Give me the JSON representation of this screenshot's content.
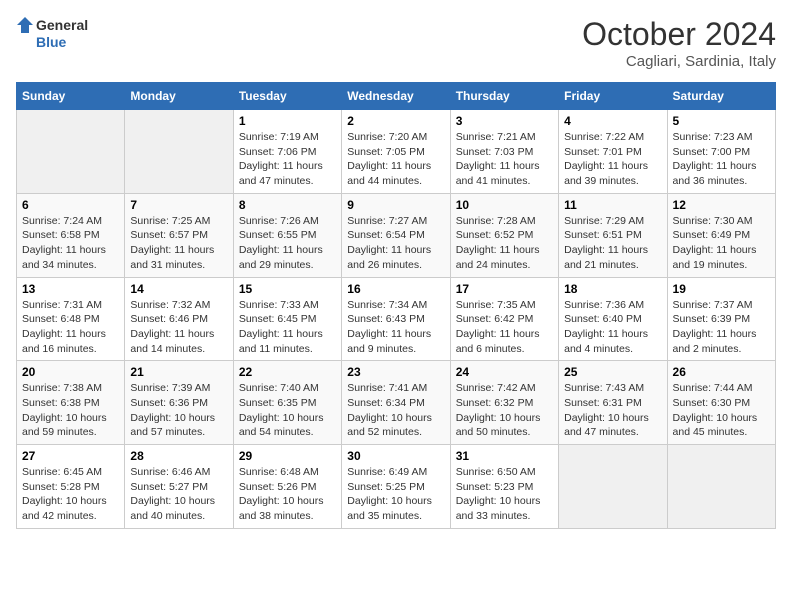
{
  "header": {
    "logo_line1": "General",
    "logo_line2": "Blue",
    "month": "October 2024",
    "location": "Cagliari, Sardinia, Italy"
  },
  "weekdays": [
    "Sunday",
    "Monday",
    "Tuesday",
    "Wednesday",
    "Thursday",
    "Friday",
    "Saturday"
  ],
  "weeks": [
    [
      {
        "day": null
      },
      {
        "day": null
      },
      {
        "day": "1",
        "sunrise": "Sunrise: 7:19 AM",
        "sunset": "Sunset: 7:06 PM",
        "daylight": "Daylight: 11 hours and 47 minutes."
      },
      {
        "day": "2",
        "sunrise": "Sunrise: 7:20 AM",
        "sunset": "Sunset: 7:05 PM",
        "daylight": "Daylight: 11 hours and 44 minutes."
      },
      {
        "day": "3",
        "sunrise": "Sunrise: 7:21 AM",
        "sunset": "Sunset: 7:03 PM",
        "daylight": "Daylight: 11 hours and 41 minutes."
      },
      {
        "day": "4",
        "sunrise": "Sunrise: 7:22 AM",
        "sunset": "Sunset: 7:01 PM",
        "daylight": "Daylight: 11 hours and 39 minutes."
      },
      {
        "day": "5",
        "sunrise": "Sunrise: 7:23 AM",
        "sunset": "Sunset: 7:00 PM",
        "daylight": "Daylight: 11 hours and 36 minutes."
      }
    ],
    [
      {
        "day": "6",
        "sunrise": "Sunrise: 7:24 AM",
        "sunset": "Sunset: 6:58 PM",
        "daylight": "Daylight: 11 hours and 34 minutes."
      },
      {
        "day": "7",
        "sunrise": "Sunrise: 7:25 AM",
        "sunset": "Sunset: 6:57 PM",
        "daylight": "Daylight: 11 hours and 31 minutes."
      },
      {
        "day": "8",
        "sunrise": "Sunrise: 7:26 AM",
        "sunset": "Sunset: 6:55 PM",
        "daylight": "Daylight: 11 hours and 29 minutes."
      },
      {
        "day": "9",
        "sunrise": "Sunrise: 7:27 AM",
        "sunset": "Sunset: 6:54 PM",
        "daylight": "Daylight: 11 hours and 26 minutes."
      },
      {
        "day": "10",
        "sunrise": "Sunrise: 7:28 AM",
        "sunset": "Sunset: 6:52 PM",
        "daylight": "Daylight: 11 hours and 24 minutes."
      },
      {
        "day": "11",
        "sunrise": "Sunrise: 7:29 AM",
        "sunset": "Sunset: 6:51 PM",
        "daylight": "Daylight: 11 hours and 21 minutes."
      },
      {
        "day": "12",
        "sunrise": "Sunrise: 7:30 AM",
        "sunset": "Sunset: 6:49 PM",
        "daylight": "Daylight: 11 hours and 19 minutes."
      }
    ],
    [
      {
        "day": "13",
        "sunrise": "Sunrise: 7:31 AM",
        "sunset": "Sunset: 6:48 PM",
        "daylight": "Daylight: 11 hours and 16 minutes."
      },
      {
        "day": "14",
        "sunrise": "Sunrise: 7:32 AM",
        "sunset": "Sunset: 6:46 PM",
        "daylight": "Daylight: 11 hours and 14 minutes."
      },
      {
        "day": "15",
        "sunrise": "Sunrise: 7:33 AM",
        "sunset": "Sunset: 6:45 PM",
        "daylight": "Daylight: 11 hours and 11 minutes."
      },
      {
        "day": "16",
        "sunrise": "Sunrise: 7:34 AM",
        "sunset": "Sunset: 6:43 PM",
        "daylight": "Daylight: 11 hours and 9 minutes."
      },
      {
        "day": "17",
        "sunrise": "Sunrise: 7:35 AM",
        "sunset": "Sunset: 6:42 PM",
        "daylight": "Daylight: 11 hours and 6 minutes."
      },
      {
        "day": "18",
        "sunrise": "Sunrise: 7:36 AM",
        "sunset": "Sunset: 6:40 PM",
        "daylight": "Daylight: 11 hours and 4 minutes."
      },
      {
        "day": "19",
        "sunrise": "Sunrise: 7:37 AM",
        "sunset": "Sunset: 6:39 PM",
        "daylight": "Daylight: 11 hours and 2 minutes."
      }
    ],
    [
      {
        "day": "20",
        "sunrise": "Sunrise: 7:38 AM",
        "sunset": "Sunset: 6:38 PM",
        "daylight": "Daylight: 10 hours and 59 minutes."
      },
      {
        "day": "21",
        "sunrise": "Sunrise: 7:39 AM",
        "sunset": "Sunset: 6:36 PM",
        "daylight": "Daylight: 10 hours and 57 minutes."
      },
      {
        "day": "22",
        "sunrise": "Sunrise: 7:40 AM",
        "sunset": "Sunset: 6:35 PM",
        "daylight": "Daylight: 10 hours and 54 minutes."
      },
      {
        "day": "23",
        "sunrise": "Sunrise: 7:41 AM",
        "sunset": "Sunset: 6:34 PM",
        "daylight": "Daylight: 10 hours and 52 minutes."
      },
      {
        "day": "24",
        "sunrise": "Sunrise: 7:42 AM",
        "sunset": "Sunset: 6:32 PM",
        "daylight": "Daylight: 10 hours and 50 minutes."
      },
      {
        "day": "25",
        "sunrise": "Sunrise: 7:43 AM",
        "sunset": "Sunset: 6:31 PM",
        "daylight": "Daylight: 10 hours and 47 minutes."
      },
      {
        "day": "26",
        "sunrise": "Sunrise: 7:44 AM",
        "sunset": "Sunset: 6:30 PM",
        "daylight": "Daylight: 10 hours and 45 minutes."
      }
    ],
    [
      {
        "day": "27",
        "sunrise": "Sunrise: 6:45 AM",
        "sunset": "Sunset: 5:28 PM",
        "daylight": "Daylight: 10 hours and 42 minutes."
      },
      {
        "day": "28",
        "sunrise": "Sunrise: 6:46 AM",
        "sunset": "Sunset: 5:27 PM",
        "daylight": "Daylight: 10 hours and 40 minutes."
      },
      {
        "day": "29",
        "sunrise": "Sunrise: 6:48 AM",
        "sunset": "Sunset: 5:26 PM",
        "daylight": "Daylight: 10 hours and 38 minutes."
      },
      {
        "day": "30",
        "sunrise": "Sunrise: 6:49 AM",
        "sunset": "Sunset: 5:25 PM",
        "daylight": "Daylight: 10 hours and 35 minutes."
      },
      {
        "day": "31",
        "sunrise": "Sunrise: 6:50 AM",
        "sunset": "Sunset: 5:23 PM",
        "daylight": "Daylight: 10 hours and 33 minutes."
      },
      {
        "day": null
      },
      {
        "day": null
      }
    ]
  ]
}
